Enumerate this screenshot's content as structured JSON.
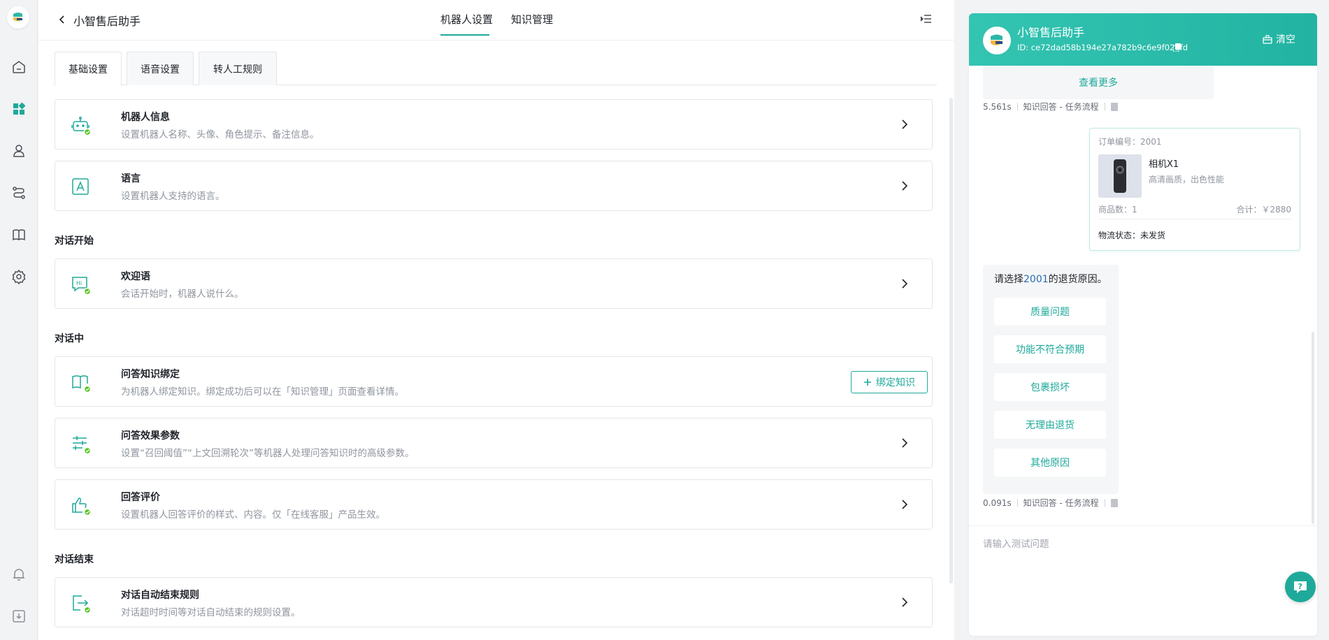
{
  "header": {
    "title": "小智售后助手",
    "tabs": [
      {
        "label": "机器人设置",
        "active": true
      },
      {
        "label": "知识管理",
        "active": false
      }
    ]
  },
  "subtabs": [
    {
      "label": "基础设置",
      "active": true
    },
    {
      "label": "语音设置",
      "active": false
    },
    {
      "label": "转人工规则",
      "active": false
    }
  ],
  "cards": {
    "robot_info": {
      "title": "机器人信息",
      "desc": "设置机器人名称、头像、角色提示、备注信息。",
      "icon": "robot-icon"
    },
    "language": {
      "title": "语言",
      "desc": "设置机器人支持的语言。",
      "icon": "language-icon"
    },
    "welcome": {
      "title": "欢迎语",
      "desc": "会话开始时，机器人说什么。",
      "icon": "chat-hi-icon"
    },
    "knowledge_bind": {
      "title": "问答知识绑定",
      "desc": "为机器人绑定知识。绑定成功后可以在「知识管理」页面查看详情。",
      "icon": "book-icon",
      "button": "绑定知识"
    },
    "qa_params": {
      "title": "问答效果参数",
      "desc": "设置“召回阈值”“上文回溯轮次”等机器人处理问答知识时的高级参数。",
      "icon": "sliders-icon"
    },
    "answer_rating": {
      "title": "回答评价",
      "desc": "设置机器人回答评价的样式、内容。仅「在线客服」产品生效。",
      "icon": "thumbs-up-icon"
    },
    "auto_end": {
      "title": "对话自动结束规则",
      "desc": "对话超时时间等对话自动结束的规则设置。",
      "icon": "exit-icon"
    }
  },
  "sections": {
    "start": "对话开始",
    "during": "对话中",
    "end": "对话结束"
  },
  "chat": {
    "name": "小智售后助手",
    "id": "ID: ce72dad58b194e27a782b9c6e9f027fd",
    "clear": "清空",
    "more": "查看更多",
    "meta1": {
      "time": "5.561s",
      "source": "知识回答 - 任务流程"
    },
    "order": {
      "order_no": "订单编号：2001",
      "product_name": "相机X1",
      "product_desc": "高清画质，出色性能",
      "qty": "商品数：1",
      "total": "合计：￥2880",
      "status": "物流状态：未发货"
    },
    "reason": {
      "prefix": "请选择",
      "highlight": "2001",
      "suffix": "的退货原因。",
      "options": [
        "质量问题",
        "功能不符合预期",
        "包裹损坏",
        "无理由退货",
        "其他原因"
      ]
    },
    "meta2": {
      "time": "0.091s",
      "source": "知识回答 - 任务流程"
    },
    "input_placeholder": "请输入测试问题"
  },
  "colors": {
    "accent": "#1fa99a",
    "highlight": "#2b6cb0",
    "badge": "#52c41a"
  }
}
